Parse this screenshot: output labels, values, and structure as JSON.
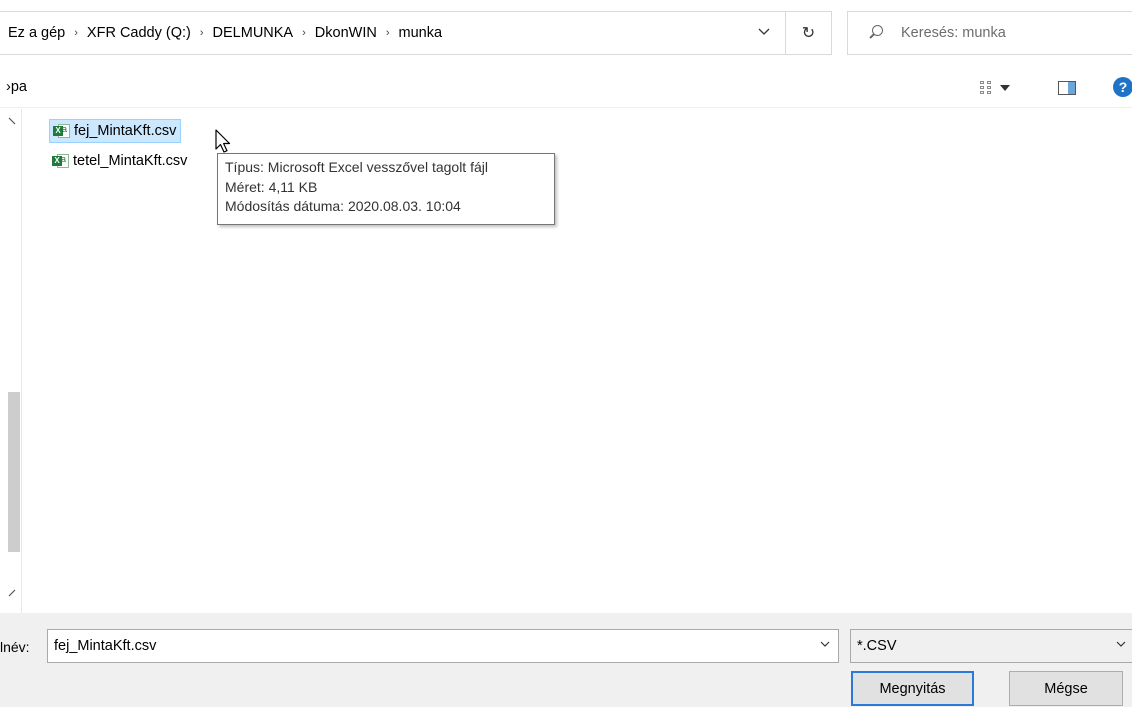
{
  "address_bar": {
    "breadcrumbs": [
      "Ez a gép",
      "XFR Caddy (Q:)",
      "DELMUNKA",
      "DkonWIN",
      "munka"
    ],
    "separator": "›",
    "refresh_glyph": "↻"
  },
  "search": {
    "placeholder": "Keresés: munka"
  },
  "toolbar": {
    "partial_label": "›pa",
    "help_glyph": "?"
  },
  "files": [
    {
      "name": "fej_MintaKft.csv",
      "icon": "excel-csv-icon",
      "selected": true
    },
    {
      "name": "tetel_MintaKft.csv",
      "icon": "excel-csv-icon",
      "selected": false
    }
  ],
  "tooltip": {
    "type_line": "Típus: Microsoft Excel vesszővel tagolt fájl",
    "size_line": "Méret: 4,11 KB",
    "modified_line": "Módosítás dátuma: 2020.08.03. 10:04"
  },
  "bottom": {
    "filename_label": "lnév:",
    "filename_value": "fej_MintaKft.csv",
    "filetype_value": "*.CSV",
    "open_button": "Megnyitás",
    "cancel_button": "Mégse"
  },
  "colors": {
    "selection_bg": "#cce8ff",
    "selection_border": "#99d1ff",
    "primary_button_border": "#2b79d8",
    "help_icon": "#1e73c7",
    "excel_green": "#1e7b3c"
  }
}
